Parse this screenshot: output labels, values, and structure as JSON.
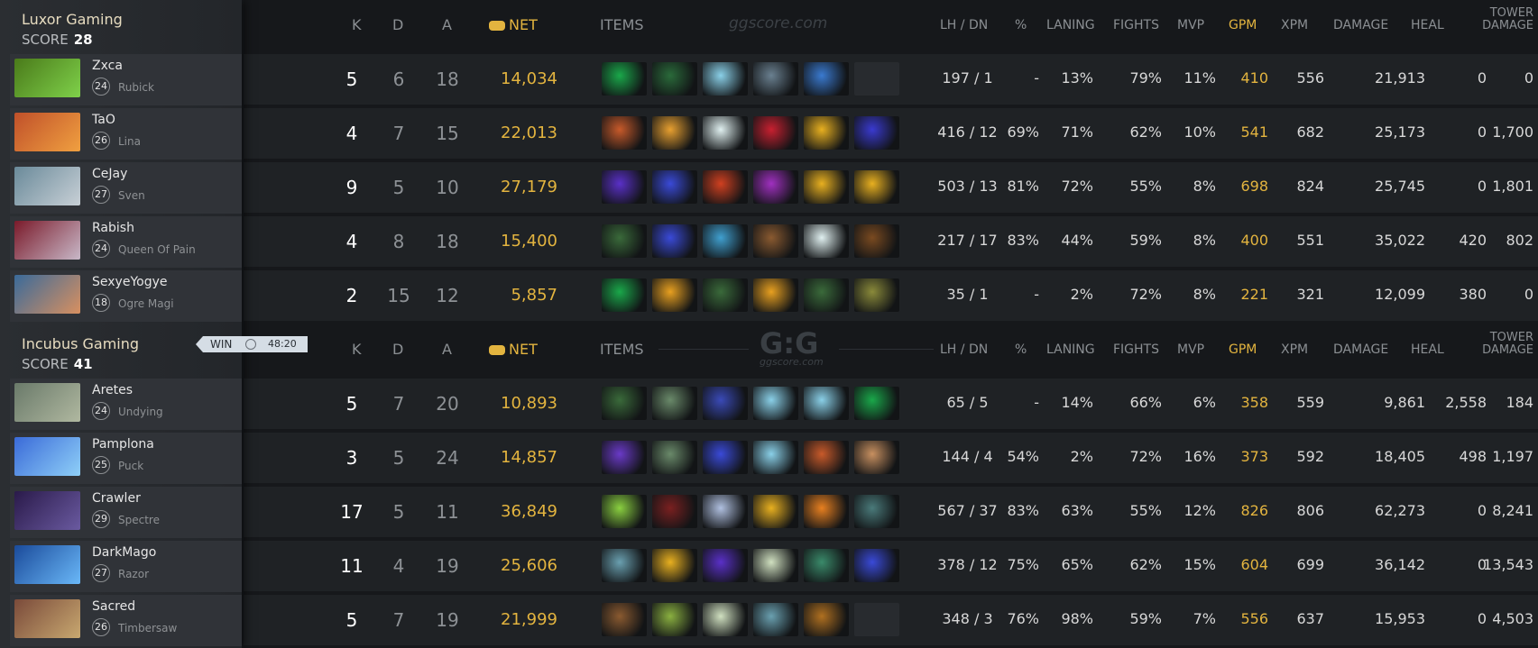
{
  "headers": {
    "k": "K",
    "d": "D",
    "a": "A",
    "net": "NET",
    "items": "ITEMS",
    "lh_dn": "LH / DN",
    "pct": "%",
    "laning": "LANING",
    "fights": "FIGHTS",
    "mvp": "MVP",
    "gpm": "GPM",
    "xpm": "XPM",
    "damage": "DAMAGE",
    "heal": "HEAL",
    "tower1": "TOWER",
    "tower2": "DAMAGE"
  },
  "watermark_top": "ggscore.com",
  "watermark_mid_logo": "G:G",
  "watermark_mid_sub": "ggscore.com",
  "win_badge": {
    "label": "WIN",
    "time": "48:20"
  },
  "teams": [
    {
      "name": "Luxor Gaming",
      "score_label": "SCORE",
      "score": "28",
      "players": [
        {
          "name": "Zxca",
          "level": "24",
          "hero": "Rubick",
          "k": "5",
          "d": "6",
          "a": "18",
          "net": "14,034",
          "lh": "197",
          "dn": "1",
          "pct": "-",
          "laning": "13%",
          "fights": "79%",
          "mvp": "11%",
          "gpm": "410",
          "xpm": "556",
          "damage": "21,913",
          "heal": "0",
          "tower": "0"
        },
        {
          "name": "TaO",
          "level": "26",
          "hero": "Lina",
          "k": "4",
          "d": "7",
          "a": "15",
          "net": "22,013",
          "lh": "416",
          "dn": "12",
          "pct": "69%",
          "laning": "71%",
          "fights": "62%",
          "mvp": "10%",
          "gpm": "541",
          "xpm": "682",
          "damage": "25,173",
          "heal": "0",
          "tower": "1,700"
        },
        {
          "name": "CeJay",
          "level": "27",
          "hero": "Sven",
          "k": "9",
          "d": "5",
          "a": "10",
          "net": "27,179",
          "lh": "503",
          "dn": "13",
          "pct": "81%",
          "laning": "72%",
          "fights": "55%",
          "mvp": "8%",
          "gpm": "698",
          "xpm": "824",
          "damage": "25,745",
          "heal": "0",
          "tower": "1,801"
        },
        {
          "name": "Rabish",
          "level": "24",
          "hero": "Queen Of Pain",
          "k": "4",
          "d": "8",
          "a": "18",
          "net": "15,400",
          "lh": "217",
          "dn": "17",
          "pct": "83%",
          "laning": "44%",
          "fights": "59%",
          "mvp": "8%",
          "gpm": "400",
          "xpm": "551",
          "damage": "35,022",
          "heal": "420",
          "tower": "802"
        },
        {
          "name": "SexyeYogye",
          "level": "18",
          "hero": "Ogre Magi",
          "k": "2",
          "d": "15",
          "a": "12",
          "net": "5,857",
          "lh": "35",
          "dn": "1",
          "pct": "-",
          "laning": "2%",
          "fights": "72%",
          "mvp": "8%",
          "gpm": "221",
          "xpm": "321",
          "damage": "12,099",
          "heal": "380",
          "tower": "0"
        }
      ]
    },
    {
      "name": "Incubus Gaming",
      "score_label": "SCORE",
      "score": "41",
      "players": [
        {
          "name": "Aretes",
          "level": "24",
          "hero": "Undying",
          "k": "5",
          "d": "7",
          "a": "20",
          "net": "10,893",
          "lh": "65",
          "dn": "5",
          "pct": "-",
          "laning": "14%",
          "fights": "66%",
          "mvp": "6%",
          "gpm": "358",
          "xpm": "559",
          "damage": "9,861",
          "heal": "2,558",
          "tower": "184"
        },
        {
          "name": "Pamplona",
          "level": "25",
          "hero": "Puck",
          "k": "3",
          "d": "5",
          "a": "24",
          "net": "14,857",
          "lh": "144",
          "dn": "4",
          "pct": "54%",
          "laning": "2%",
          "fights": "72%",
          "mvp": "16%",
          "gpm": "373",
          "xpm": "592",
          "damage": "18,405",
          "heal": "498",
          "tower": "1,197"
        },
        {
          "name": "Crawler",
          "level": "29",
          "hero": "Spectre",
          "k": "17",
          "d": "5",
          "a": "11",
          "net": "36,849",
          "lh": "567",
          "dn": "37",
          "pct": "83%",
          "laning": "63%",
          "fights": "55%",
          "mvp": "12%",
          "gpm": "826",
          "xpm": "806",
          "damage": "62,273",
          "heal": "0",
          "tower": "8,241"
        },
        {
          "name": "DarkMago",
          "level": "27",
          "hero": "Razor",
          "k": "11",
          "d": "4",
          "a": "19",
          "net": "25,606",
          "lh": "378",
          "dn": "12",
          "pct": "75%",
          "laning": "65%",
          "fights": "62%",
          "mvp": "15%",
          "gpm": "604",
          "xpm": "699",
          "damage": "36,142",
          "heal": "0",
          "tower": "13,543"
        },
        {
          "name": "Sacred",
          "level": "26",
          "hero": "Timbersaw",
          "k": "5",
          "d": "7",
          "a": "19",
          "net": "21,999",
          "lh": "348",
          "dn": "3",
          "pct": "76%",
          "laning": "98%",
          "fights": "59%",
          "mvp": "7%",
          "gpm": "556",
          "xpm": "637",
          "damage": "15,953",
          "heal": "0",
          "tower": "4,503"
        }
      ]
    }
  ],
  "colors": {
    "accent_gold": "#e3b43f",
    "portraits": [
      [
        "#4a7a1a",
        "#7fd14a"
      ],
      [
        "#c0502a",
        "#f0a040"
      ],
      [
        "#6a8a9a",
        "#c8d0d6"
      ],
      [
        "#7a1a2a",
        "#c8b8c8"
      ],
      [
        "#3a6a9a",
        "#d89060"
      ],
      [
        "#6a7a6a",
        "#b0b8a0"
      ],
      [
        "#3a6ad8",
        "#8fd0f8"
      ],
      [
        "#2a1a4a",
        "#6a5aa0"
      ],
      [
        "#1a4a9a",
        "#6ab8f8"
      ],
      [
        "#7a4a3a",
        "#c8a870"
      ]
    ],
    "items": [
      [
        "#1aa84a",
        "#2a6a3a",
        "#8ad0e8",
        "#6a8090",
        "#3a7ad0",
        null
      ],
      [
        "#c85a2a",
        "#e8a030",
        "#e0f0f0",
        "#c82030",
        "#e8b020",
        "#3a3ad0"
      ],
      [
        "#5a30c8",
        "#3a4ad8",
        "#d04020",
        "#a030c0",
        "#e8b020",
        "#e8b020"
      ],
      [
        "#3a6a3a",
        "#3a4ad8",
        "#40a0d0",
        "#8a5a30",
        "#e0f0f0",
        "#7a4a20"
      ],
      [
        "#1aa84a",
        "#e8a020",
        "#3a6a3a",
        "#e8a020",
        "#3a6a3a",
        "#8a8a3a"
      ],
      [
        "#3a6a3a",
        "#6a8a6a",
        "#3a4ab8",
        "#8ad0e8",
        "#8ad0e8",
        "#1aa84a"
      ],
      [
        "#6a3ac8",
        "#6a8a6a",
        "#3a4ad8",
        "#8ad0e8",
        "#c85a2a",
        "#c89060"
      ],
      [
        "#8ad040",
        "#7a2020",
        "#b0c0e0",
        "#e8b020",
        "#e88020",
        "#4a7a7a"
      ],
      [
        "#6aa0b0",
        "#e8b020",
        "#5a30c8",
        "#d0e0c0",
        "#3a8a6a",
        "#3a4ad8"
      ],
      [
        "#8a5a30",
        "#8ab040",
        "#d0e0c0",
        "#6aa0b0",
        "#b07020",
        null
      ]
    ]
  }
}
